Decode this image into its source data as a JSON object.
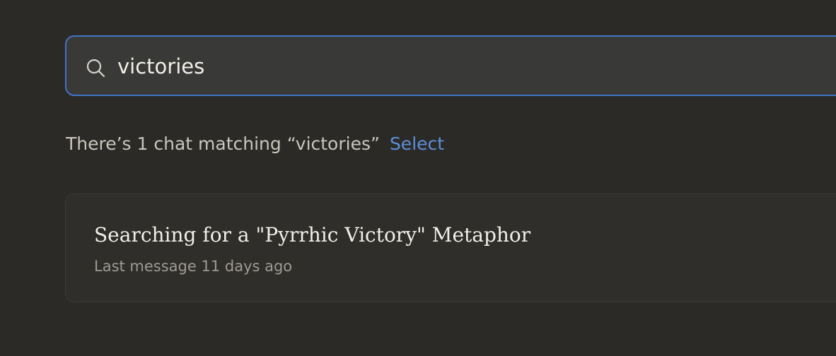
{
  "search": {
    "value": "victories",
    "icon": "search-icon"
  },
  "results_summary": {
    "text": "There’s 1 chat matching “victories”",
    "select_label": "Select"
  },
  "results": [
    {
      "title": "Searching for a \"Pyrrhic Victory\" Metaphor",
      "meta": "Last message 11 days ago"
    }
  ],
  "colors": {
    "background": "#2b2a27",
    "accent": "#5b8fd6",
    "focus_border": "#3f75c4"
  }
}
